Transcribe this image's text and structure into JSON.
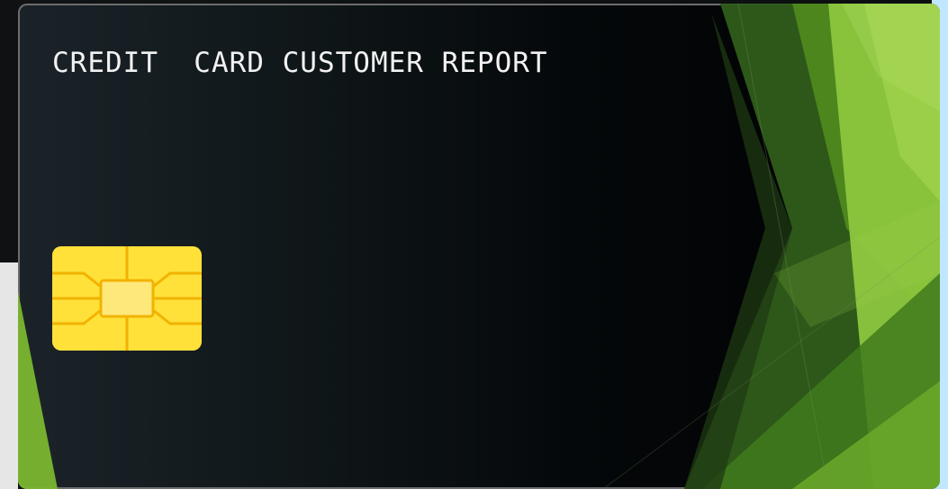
{
  "card": {
    "title": "CREDIT  CARD CUSTOMER REPORT",
    "chip_icon": "sim-chip-icon",
    "colors": {
      "background_dark": "#05080a",
      "text": "#f2f2f2",
      "chip": "#ffe13a",
      "green_dark": "#2f5d1a",
      "green_mid": "#4f8a1d",
      "green_light": "#8cc63e",
      "green_bright": "#9fd14a"
    }
  }
}
